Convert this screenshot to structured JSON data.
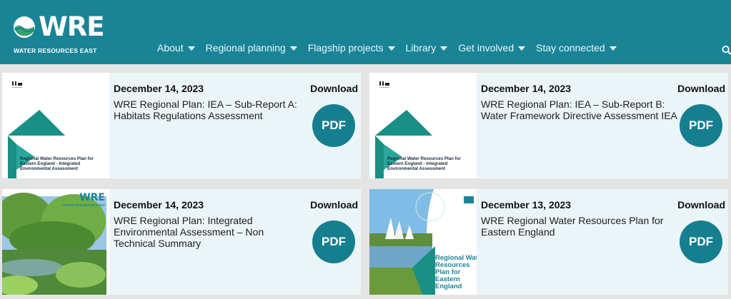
{
  "header": {
    "logo_text": "WRE",
    "logo_tagline": "WATER RESOURCES EAST",
    "nav": [
      "About",
      "Regional planning",
      "Flagship projects",
      "Library",
      "Get involved",
      "Stay connected"
    ],
    "search_icon": "search-icon"
  },
  "colors": {
    "header_bg": "#1a8497",
    "card_bg": "#ebf5f7",
    "pdf_button": "#157f8f"
  },
  "cards": [
    {
      "date": "December 14, 2023",
      "title": "WRE Regional Plan: IEA – Sub-Report A: Habitats Regulations Assessment",
      "download_label": "Download",
      "button_label": "PDF",
      "cover_title": "Regional Water Resources Plan for Eastern England - Integrated Environmental Assessment"
    },
    {
      "date": "December 14, 2023",
      "title": "WRE Regional Plan: IEA – Sub-Report B: Water Framework Directive Assessment IEA",
      "download_label": "Download",
      "button_label": "PDF",
      "cover_title": "Regional Water Resources Plan for Eastern England - Integrated Environmental Assessment"
    },
    {
      "date": "December 14, 2023",
      "title": "WRE Regional Plan: Integrated Environmental Assessment – Non Technical Summary",
      "download_label": "Download",
      "button_label": "PDF",
      "cover_logo": "WRE",
      "cover_tagline": "WATER RESOURCES EAST"
    },
    {
      "date": "December 13, 2023",
      "title": "WRE Regional Water Resources Plan for Eastern England",
      "download_label": "Download",
      "button_label": "PDF",
      "cover_title": "Regional Water Resources Plan for Eastern England"
    }
  ]
}
